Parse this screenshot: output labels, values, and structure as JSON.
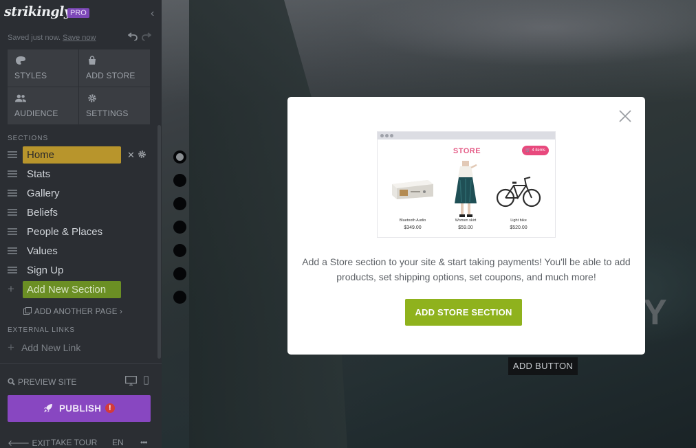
{
  "app": {
    "logo": "strikingly",
    "badge": "PRO"
  },
  "status": {
    "saved": "Saved just now.",
    "save_now": "Save now"
  },
  "tools": [
    {
      "label": "STYLES",
      "icon": "palette-icon"
    },
    {
      "label": "ADD STORE",
      "icon": "store-bag-icon"
    },
    {
      "label": "AUDIENCE",
      "icon": "people-icon"
    },
    {
      "label": "SETTINGS",
      "icon": "gear-icon"
    }
  ],
  "sections": {
    "heading": "SECTIONS",
    "items": [
      "Home",
      "Stats",
      "Gallery",
      "Beliefs",
      "People & Places",
      "Values",
      "Sign Up"
    ],
    "active": "Home",
    "add_new": "Add New Section",
    "add_page": "ADD ANOTHER PAGE ›"
  },
  "external_links": {
    "heading": "EXTERNAL LINKS",
    "add": "Add New Link"
  },
  "preview": {
    "label": "PREVIEW SITE"
  },
  "publish": {
    "label": "PUBLISH",
    "warning": "!"
  },
  "footer": {
    "exit": "EXIT",
    "tour": "TAKE TOUR",
    "lang": "EN",
    "more": "•••"
  },
  "canvas": {
    "add_button": "ADD BUTTON",
    "partial_heading": "Y"
  },
  "modal": {
    "preview": {
      "title": "STORE",
      "cart": "4 items",
      "products": [
        {
          "name": "Bluetooth Audio",
          "price": "$349.00"
        },
        {
          "name": "Women skirt",
          "price": "$59.00"
        },
        {
          "name": "Light bike",
          "price": "$520.00"
        }
      ]
    },
    "text": "Add a Store section to your site & start taking payments! You'll be able to add products, set shipping options, set coupons, and much more!",
    "cta": "ADD STORE SECTION"
  },
  "colors": {
    "active_section": "#b8952c",
    "add_section": "#6b8f24",
    "publish": "#8847c1",
    "cta": "#8fb21d",
    "store_accent": "#e45b86"
  }
}
